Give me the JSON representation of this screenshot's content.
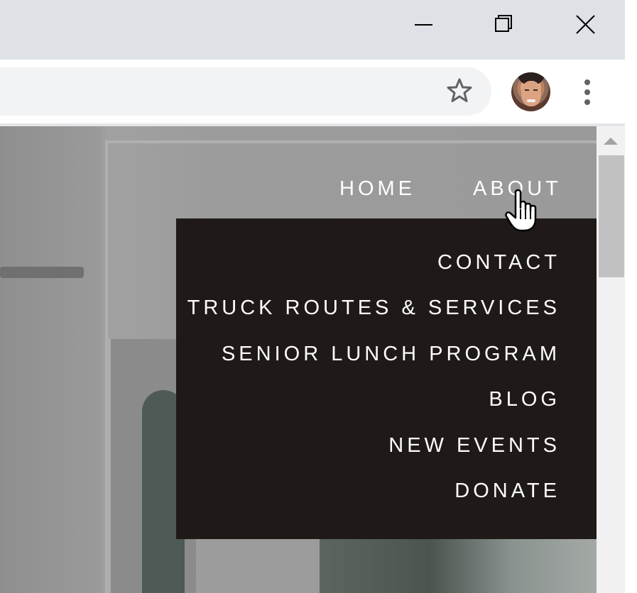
{
  "window_controls": {
    "minimize_icon": "minimize-icon",
    "restore_icon": "restore-icon",
    "close_icon": "close-icon"
  },
  "toolbar": {
    "bookmark_icon": "star-icon",
    "profile_icon": "avatar",
    "menu_icon": "more-vert-icon"
  },
  "nav": {
    "items": [
      {
        "label": "HOME"
      },
      {
        "label": "ABOUT"
      }
    ]
  },
  "dropdown": {
    "items": [
      {
        "label": "CONTACT"
      },
      {
        "label": "TRUCK ROUTES & SERVICES"
      },
      {
        "label": "SENIOR LUNCH PROGRAM"
      },
      {
        "label": "BLOG"
      },
      {
        "label": "NEW EVENTS"
      },
      {
        "label": "DONATE"
      }
    ]
  },
  "colors": {
    "titlebar": "#dee1e6",
    "omnibox": "#f1f3f4",
    "dropdown_bg": "#1f1a18",
    "nav_text": "#ffffff"
  }
}
